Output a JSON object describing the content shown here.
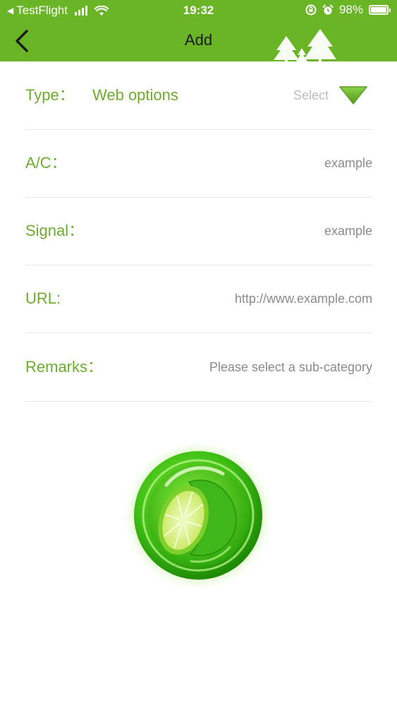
{
  "status_bar": {
    "back_app_label": "TestFlight",
    "time": "19:32",
    "battery_percent": "98%",
    "battery_level": 0.98
  },
  "nav": {
    "title": "Add",
    "back_icon": "chevron-left-icon",
    "decoration_icon": "trees-icon"
  },
  "form": {
    "type": {
      "label": "Type：",
      "value": "Web options",
      "select_label": "Select"
    },
    "account": {
      "label": "A/C：",
      "placeholder": "example"
    },
    "signal": {
      "label": "Signal：",
      "placeholder": "example"
    },
    "url": {
      "label": "URL:",
      "placeholder": "http://www.example.com"
    },
    "remarks": {
      "label": "Remarks：",
      "placeholder": "Please select a sub-category"
    }
  },
  "submit_icon": "lime-icon",
  "colors": {
    "header_green": "#69b526",
    "label_green": "#6cad2d",
    "placeholder_gray": "#8b8b8b",
    "divider": "#e6e6e6"
  }
}
